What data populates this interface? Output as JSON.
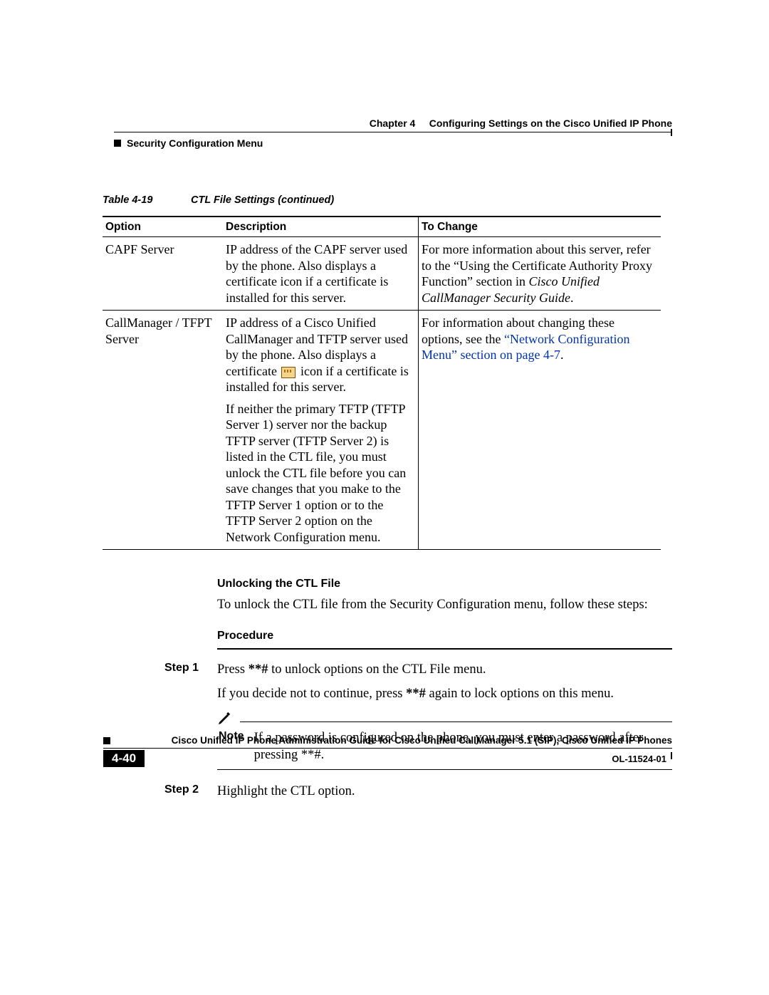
{
  "header": {
    "chapter": "Chapter 4",
    "chapter_title": "Configuring Settings on the Cisco Unified IP Phone",
    "section": "Security Configuration Menu"
  },
  "table": {
    "caption_number": "Table 4-19",
    "caption_title": "CTL File Settings (continued)",
    "columns": {
      "option": "Option",
      "description": "Description",
      "to_change": "To Change"
    },
    "rows": [
      {
        "option": "CAPF Server",
        "description": "IP address of the CAPF server used by the phone. Also displays a certificate icon if a certificate is installed for this server.",
        "to_change_pre": "For more information about this server, refer to the “Using the Certificate Authority Proxy Function” section in ",
        "to_change_ital": "Cisco Unified CallManager Security Guide",
        "to_change_post": "."
      },
      {
        "option": "CallManager / TFPT Server",
        "description_p1_pre": "IP address of a Cisco Unified CallManager and TFTP server used by the phone. Also displays a certificate ",
        "description_p1_post": " icon if a certificate is installed for this server.",
        "description_p2": "If neither the primary TFTP (TFTP Server 1) server nor the backup TFTP server (TFTP Server 2) is listed in the CTL file, you must unlock the CTL file before you can save changes that you make to the TFTP Server 1 option or to the TFTP Server 2 option on the Network Configuration menu.",
        "to_change_pre": "For information about changing these options, see the ",
        "to_change_link": "“Network Configuration Menu” section on page 4-7",
        "to_change_post": "."
      }
    ]
  },
  "unlock": {
    "heading": "Unlocking the CTL File",
    "intro": "To unlock the CTL file from the Security Configuration menu, follow these steps:",
    "procedure_label": "Procedure",
    "steps": [
      {
        "label": "Step 1",
        "line1_pre": "Press ",
        "line1_bold": "**#",
        "line1_post": " to unlock options on the CTL File menu.",
        "line2_pre": "If you decide not to continue, press ",
        "line2_bold": "**#",
        "line2_post": " again to lock options on this menu.",
        "note_label": "Note",
        "note_text": "If a password is configured on the phone, you must enter a password after pressing **#."
      },
      {
        "label": "Step 2",
        "line1": "Highlight the CTL option."
      }
    ]
  },
  "footer": {
    "guide_title": "Cisco Unified IP Phone Administration Guide for Cisco Unified CallManager 5.1 (SIP), Cisco Unified IP Phones",
    "page_number": "4-40",
    "doc_id": "OL-11524-01"
  }
}
